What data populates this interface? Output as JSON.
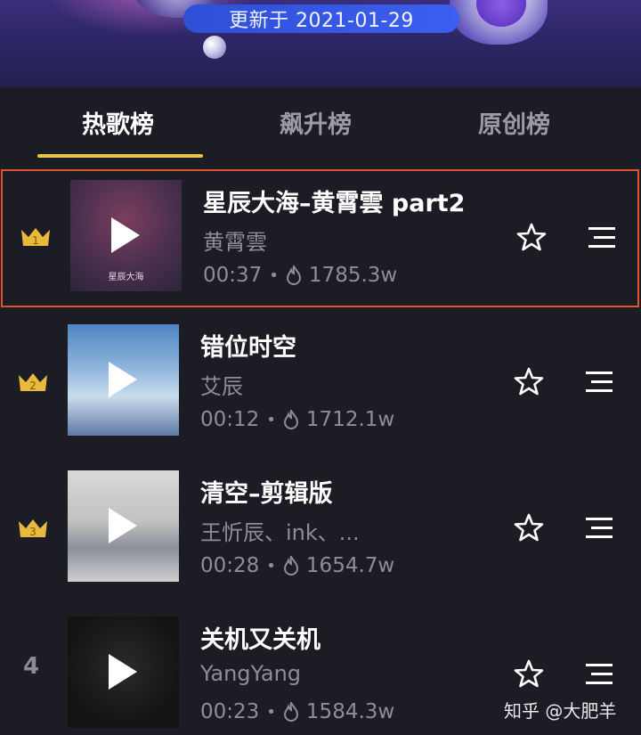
{
  "banner": {
    "update_text": "更新于 2021-01-29"
  },
  "tabs": [
    {
      "label": "热歌榜",
      "active": true
    },
    {
      "label": "飙升榜",
      "active": false
    },
    {
      "label": "原创榜",
      "active": false
    }
  ],
  "colors": {
    "accent_tab": "#e8c93e",
    "crown": "#e9b93b",
    "highlight_border": "#e0532f"
  },
  "songs": [
    {
      "rank": "1",
      "title": "星辰大海–黄霄雲 part2",
      "artist": "黄霄雲",
      "duration": "00:37",
      "plays": "1785.3w",
      "cover_caption": "星辰大海"
    },
    {
      "rank": "2",
      "title": "错位时空",
      "artist": "艾辰",
      "duration": "00:12",
      "plays": "1712.1w"
    },
    {
      "rank": "3",
      "title": "清空–剪辑版",
      "artist": "王忻辰、ink、...",
      "duration": "00:28",
      "plays": "1654.7w"
    },
    {
      "rank": "4",
      "title": "关机又关机",
      "artist": "YangYang",
      "duration": "00:23",
      "plays": "1584.3w"
    }
  ],
  "watermark": "知乎 @大肥羊"
}
